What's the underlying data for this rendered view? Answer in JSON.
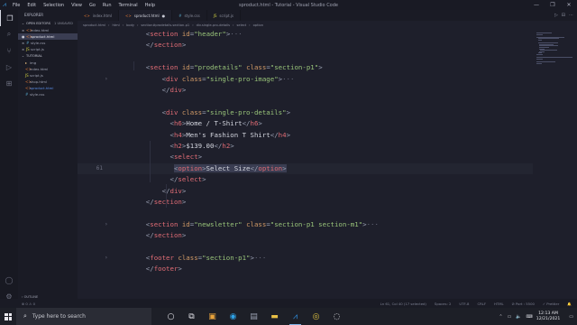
{
  "window": {
    "menu": [
      "File",
      "Edit",
      "Selection",
      "View",
      "Go",
      "Run",
      "Terminal",
      "Help"
    ],
    "title": "sproduct.html - Tutorial - Visual Studio Code",
    "controls": [
      "—",
      "❐",
      "✕"
    ]
  },
  "activity_bar": {
    "icons": [
      "files-icon",
      "search-icon",
      "source-control-icon",
      "run-debug-icon",
      "extensions-icon"
    ],
    "bottom_icons": [
      "account-icon",
      "settings-icon"
    ]
  },
  "sidebar": {
    "header": "EXPLORER",
    "open_editors_label": "OPEN EDITORS",
    "open_editors_badge": "1 UNSAVED",
    "open_editors": [
      {
        "name": "index.html",
        "color": "#e37933",
        "glyph": "<>"
      },
      {
        "name": "sproduct.html",
        "color": "#e37933",
        "glyph": "<>",
        "unsaved": true
      },
      {
        "name": "style.css",
        "color": "#519aba",
        "glyph": "#"
      },
      {
        "name": "script.js",
        "color": "#cbcb41",
        "glyph": "JS"
      }
    ],
    "folder_label": "TUTORIAL",
    "tree": [
      {
        "name": "img",
        "type": "folder",
        "color": "#dcb67a",
        "glyph": "▸"
      },
      {
        "name": "index.html",
        "type": "file",
        "color": "#e37933",
        "glyph": "<>"
      },
      {
        "name": "script.js",
        "type": "file",
        "color": "#cbcb41",
        "glyph": "JS"
      },
      {
        "name": "shop.html",
        "type": "file",
        "color": "#e37933",
        "glyph": "<>"
      },
      {
        "name": "sproduct.html",
        "type": "file",
        "color": "#e37933",
        "glyph": "<>",
        "active": true
      },
      {
        "name": "style.css",
        "type": "file",
        "color": "#519aba",
        "glyph": "#"
      }
    ],
    "outline_label": "OUTLINE",
    "timeline_label": "TIMELINE"
  },
  "tabs": [
    {
      "label": "index.html",
      "icon_color": "#e37933",
      "glyph": "<>"
    },
    {
      "label": "sproduct.html",
      "icon_color": "#e37933",
      "glyph": "<>",
      "active": true,
      "dirty": "●"
    },
    {
      "label": "style.css",
      "icon_color": "#519aba",
      "glyph": "#"
    },
    {
      "label": "script.js",
      "icon_color": "#cbcb41",
      "glyph": "JS"
    }
  ],
  "tab_actions": [
    "▷",
    "⊟",
    "⋯"
  ],
  "breadcrumb": [
    "sproduct.html",
    "html",
    "body",
    "section#prodetails.section-p1",
    "div.single-pro-details",
    "select",
    "option"
  ],
  "editor": {
    "current_line_number": "61",
    "lines": [
      {
        "ln": "",
        "fold": "",
        "indent": 4,
        "tokens": [
          [
            "pn",
            "<"
          ],
          [
            "tg",
            "section"
          ],
          [
            "at",
            " id"
          ],
          [
            "pn",
            "="
          ],
          [
            "st",
            "\"header\""
          ],
          [
            "pn",
            ">"
          ],
          [
            "ellip",
            "···"
          ]
        ]
      },
      {
        "ln": "",
        "fold": "",
        "indent": 4,
        "tokens": [
          [
            "pn",
            "</"
          ],
          [
            "tg",
            "section"
          ],
          [
            "pn",
            ">"
          ]
        ]
      },
      {
        "ln": "",
        "fold": "",
        "indent": 0,
        "tokens": []
      },
      {
        "ln": "",
        "fold": "",
        "indent": 4,
        "tokens": [
          [
            "pn",
            "<"
          ],
          [
            "tg",
            "section"
          ],
          [
            "at",
            " id"
          ],
          [
            "pn",
            "="
          ],
          [
            "st",
            "\"prodetails\""
          ],
          [
            "at",
            " class"
          ],
          [
            "pn",
            "="
          ],
          [
            "st",
            "\"section-p1\""
          ],
          [
            "pn",
            ">"
          ]
        ]
      },
      {
        "ln": "",
        "fold": "›",
        "indent": 8,
        "tokens": [
          [
            "pn",
            "<"
          ],
          [
            "tg",
            "div"
          ],
          [
            "at",
            " class"
          ],
          [
            "pn",
            "="
          ],
          [
            "st",
            "\"single-pro-image\""
          ],
          [
            "pn",
            ">"
          ],
          [
            "ellip",
            "···"
          ]
        ]
      },
      {
        "ln": "",
        "fold": "",
        "indent": 8,
        "tokens": [
          [
            "pn",
            "</"
          ],
          [
            "tg",
            "div"
          ],
          [
            "pn",
            ">"
          ]
        ]
      },
      {
        "ln": "",
        "fold": "",
        "indent": 0,
        "tokens": []
      },
      {
        "ln": "",
        "fold": "",
        "indent": 8,
        "tokens": [
          [
            "pn",
            "<"
          ],
          [
            "tg",
            "div"
          ],
          [
            "at",
            " class"
          ],
          [
            "pn",
            "="
          ],
          [
            "st",
            "\"single-pro-details\""
          ],
          [
            "pn",
            ">"
          ]
        ]
      },
      {
        "ln": "",
        "fold": "",
        "indent": 10,
        "tokens": [
          [
            "pn",
            "<"
          ],
          [
            "tg",
            "h6"
          ],
          [
            "pn",
            ">"
          ],
          [
            "tx",
            "Home / T-Shirt"
          ],
          [
            "pn",
            "</"
          ],
          [
            "tg",
            "h6"
          ],
          [
            "pn",
            ">"
          ]
        ]
      },
      {
        "ln": "",
        "fold": "",
        "indent": 10,
        "tokens": [
          [
            "pn",
            "<"
          ],
          [
            "tg",
            "h4"
          ],
          [
            "pn",
            ">"
          ],
          [
            "tx",
            "Men's Fashion T Shirt"
          ],
          [
            "pn",
            "</"
          ],
          [
            "tg",
            "h4"
          ],
          [
            "pn",
            ">"
          ]
        ]
      },
      {
        "ln": "",
        "fold": "",
        "indent": 10,
        "tokens": [
          [
            "pn",
            "<"
          ],
          [
            "tg",
            "h2"
          ],
          [
            "pn",
            ">"
          ],
          [
            "tx",
            "$139.00"
          ],
          [
            "pn",
            "</"
          ],
          [
            "tg",
            "h2"
          ],
          [
            "pn",
            ">"
          ]
        ]
      },
      {
        "ln": "",
        "fold": "",
        "indent": 10,
        "tokens": [
          [
            "pn",
            "<"
          ],
          [
            "tg",
            "select"
          ],
          [
            "pn",
            ">"
          ]
        ]
      },
      {
        "ln": "61",
        "fold": "",
        "indent": 11,
        "current": true,
        "tokens": [
          [
            "pn",
            "<"
          ],
          [
            "tg",
            "option"
          ],
          [
            "pn",
            ">"
          ],
          [
            "tx",
            "Select Size"
          ],
          [
            "pn",
            "</"
          ],
          [
            "tg",
            "option"
          ],
          [
            "pn",
            ">"
          ]
        ]
      },
      {
        "ln": "",
        "fold": "",
        "indent": 10,
        "tokens": [
          [
            "pn",
            "</"
          ],
          [
            "tg",
            "select"
          ],
          [
            "pn",
            ">"
          ]
        ]
      },
      {
        "ln": "",
        "fold": "",
        "indent": 8,
        "tokens": [
          [
            "pn",
            "</"
          ],
          [
            "tg",
            "div"
          ],
          [
            "pn",
            ">"
          ]
        ]
      },
      {
        "ln": "",
        "fold": "",
        "indent": 4,
        "tokens": [
          [
            "pn",
            "</"
          ],
          [
            "tg",
            "section"
          ],
          [
            "pn",
            ">"
          ]
        ]
      },
      {
        "ln": "",
        "fold": "",
        "indent": 0,
        "tokens": []
      },
      {
        "ln": "",
        "fold": "›",
        "indent": 4,
        "tokens": [
          [
            "pn",
            "<"
          ],
          [
            "tg",
            "section"
          ],
          [
            "at",
            " id"
          ],
          [
            "pn",
            "="
          ],
          [
            "st",
            "\"newsletter\""
          ],
          [
            "at",
            " class"
          ],
          [
            "pn",
            "="
          ],
          [
            "st",
            "\"section-p1 section-m1\""
          ],
          [
            "pn",
            ">"
          ],
          [
            "ellip",
            "···"
          ]
        ]
      },
      {
        "ln": "",
        "fold": "",
        "indent": 4,
        "tokens": [
          [
            "pn",
            "</"
          ],
          [
            "tg",
            "section"
          ],
          [
            "pn",
            ">"
          ]
        ]
      },
      {
        "ln": "",
        "fold": "",
        "indent": 0,
        "tokens": []
      },
      {
        "ln": "",
        "fold": "›",
        "indent": 4,
        "tokens": [
          [
            "pn",
            "<"
          ],
          [
            "tg",
            "footer"
          ],
          [
            "at",
            " class"
          ],
          [
            "pn",
            "="
          ],
          [
            "st",
            "\"section-p1\""
          ],
          [
            "pn",
            ">"
          ],
          [
            "ellip",
            "···"
          ]
        ]
      },
      {
        "ln": "",
        "fold": "",
        "indent": 4,
        "tokens": [
          [
            "pn",
            "</"
          ],
          [
            "tg",
            "footer"
          ],
          [
            "pn",
            ">"
          ]
        ]
      }
    ]
  },
  "status_bar": {
    "left": [
      "⊗ 0 ⚠ 0"
    ],
    "right": [
      "Ln 61, Col 40 (17 selected)",
      "Spaces: 2",
      "UTF-8",
      "CRLF",
      "HTML",
      "⊘ Port : 5500",
      "✓ Prettier",
      "🔔"
    ]
  },
  "taskbar": {
    "search_placeholder": "Type here to search",
    "apps": [
      {
        "name": "cortana-icon",
        "glyph": "○",
        "color": "#e6e6ec"
      },
      {
        "name": "task-view-icon",
        "glyph": "⧉",
        "color": "#e6e6ec"
      },
      {
        "name": "media-icon",
        "glyph": "▣",
        "color": "#e8a33c"
      },
      {
        "name": "edge-icon",
        "glyph": "◉",
        "color": "#2fa3e8"
      },
      {
        "name": "store-icon",
        "glyph": "▤",
        "color": "#9aa0b2"
      },
      {
        "name": "file-explorer-icon",
        "glyph": "▬",
        "color": "#e9c046"
      },
      {
        "name": "vscode-icon",
        "glyph": "⩘",
        "color": "#2f8fe0",
        "active": true
      },
      {
        "name": "chrome-icon",
        "glyph": "◎",
        "color": "#e2c541"
      },
      {
        "name": "obs-icon",
        "glyph": "◌",
        "color": "#d9d9de"
      }
    ],
    "tray": [
      "⌃",
      "▭",
      "🔈",
      "⌨"
    ],
    "time": "12:13 AM",
    "date": "12/21/2021"
  }
}
